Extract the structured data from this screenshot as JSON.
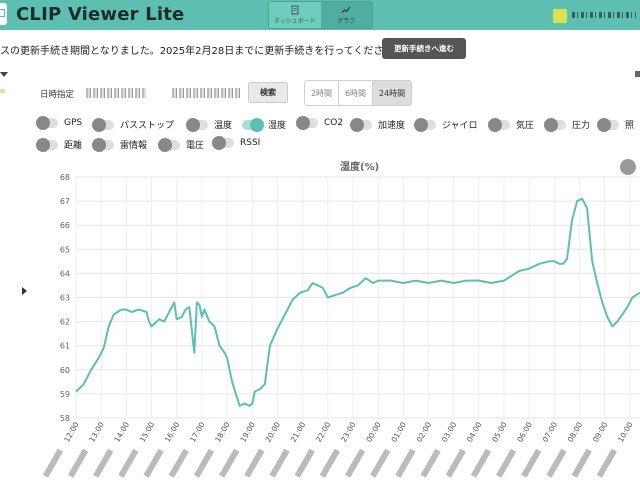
{
  "header": {
    "title": "CLIP Viewer Lite",
    "nav": [
      {
        "label": "ダッシュボード",
        "icon": "document-icon",
        "active": false
      },
      {
        "label": "グラフ",
        "icon": "line-graph-icon",
        "active": true
      }
    ],
    "avatar_color": "#d7e24e"
  },
  "notice": {
    "text": "スの更新手続き期間となりました。2025年2月28日までに更新手続きを行ってください。",
    "button_label": "更新手続きへ進む"
  },
  "filters": {
    "date_label": "日時指定",
    "search_label": "検索",
    "ranges": [
      "2時間",
      "6時間",
      "24時間"
    ],
    "selected_range": "24時間"
  },
  "toggles": [
    {
      "label": "GPS",
      "on": false
    },
    {
      "label": "パスストップ",
      "on": false
    },
    {
      "label": "温度",
      "on": false
    },
    {
      "label": "湿度",
      "on": true
    },
    {
      "label": "CO2",
      "on": false
    },
    {
      "label": "加速度",
      "on": false
    },
    {
      "label": "ジャイロ",
      "on": false
    },
    {
      "label": "気圧",
      "on": false
    },
    {
      "label": "圧力",
      "on": false
    },
    {
      "label": "照",
      "on": false
    },
    {
      "label": "距離",
      "on": false
    },
    {
      "label": "雷情報",
      "on": false
    },
    {
      "label": "電圧",
      "on": false
    },
    {
      "label": "RSSI",
      "on": false
    }
  ],
  "chart_data": {
    "type": "line",
    "title": "湿度(%)",
    "ylim": [
      58,
      68
    ],
    "yticks": [
      58,
      59,
      60,
      61,
      62,
      63,
      64,
      65,
      66,
      67,
      68
    ],
    "xtick_labels": [
      "12:00",
      "13:00",
      "14:00",
      "15:00",
      "16:00",
      "17:00",
      "18:00",
      "19:00",
      "20:00",
      "21:00",
      "22:00",
      "23:00",
      "00:00",
      "01:00",
      "02:00",
      "03:00",
      "04:00",
      "05:00",
      "06:00",
      "07:00",
      "08:00",
      "09:00",
      "10:00"
    ],
    "xlim": [
      12.0,
      34.4
    ],
    "series": [
      {
        "color": "#5cbfb0",
        "x": [
          12.0,
          12.3,
          12.6,
          12.9,
          13.1,
          13.3,
          13.5,
          13.8,
          14.0,
          14.2,
          14.5,
          14.8,
          14.9,
          15.0,
          15.2,
          15.3,
          15.5,
          15.7,
          15.9,
          16.0,
          16.2,
          16.35,
          16.5,
          16.7,
          16.8,
          16.9,
          17.0,
          17.1,
          17.3,
          17.5,
          17.7,
          17.9,
          18.0,
          18.2,
          18.35,
          18.5,
          18.7,
          18.9,
          19.0,
          19.1,
          19.3,
          19.5,
          19.7,
          20.0,
          20.3,
          20.6,
          20.9,
          21.2,
          21.4,
          21.6,
          21.8,
          22.0,
          22.3,
          22.6,
          22.9,
          23.2,
          23.5,
          23.8,
          24.0,
          24.5,
          25.0,
          25.5,
          26.0,
          26.5,
          27.0,
          27.5,
          28.0,
          28.5,
          29.0,
          29.3,
          29.6,
          30.0,
          30.4,
          30.8,
          31.0,
          31.2,
          31.35,
          31.5,
          31.7,
          31.9,
          32.1,
          32.3,
          32.5,
          32.7,
          32.9,
          33.1,
          33.3,
          33.5,
          33.7,
          33.9,
          34.1,
          34.4
        ],
        "y": [
          59.1,
          59.4,
          60.0,
          60.5,
          60.9,
          61.8,
          62.3,
          62.5,
          62.5,
          62.4,
          62.5,
          62.4,
          62.0,
          61.8,
          62.0,
          62.1,
          62.0,
          62.4,
          62.8,
          62.1,
          62.2,
          62.5,
          62.6,
          60.7,
          62.8,
          62.7,
          62.2,
          62.5,
          62.0,
          61.8,
          61.0,
          60.7,
          60.5,
          59.5,
          59.0,
          58.5,
          58.6,
          58.5,
          58.6,
          59.1,
          59.2,
          59.4,
          61.0,
          61.7,
          62.3,
          62.9,
          63.2,
          63.3,
          63.6,
          63.5,
          63.4,
          63.0,
          63.1,
          63.2,
          63.4,
          63.5,
          63.8,
          63.6,
          63.7,
          63.7,
          63.6,
          63.7,
          63.6,
          63.7,
          63.6,
          63.7,
          63.7,
          63.6,
          63.7,
          63.9,
          64.1,
          64.2,
          64.4,
          64.5,
          64.5,
          64.4,
          64.4,
          64.6,
          66.2,
          67.0,
          67.1,
          66.7,
          64.5,
          63.6,
          62.8,
          62.2,
          61.8,
          62.0,
          62.3,
          62.6,
          63.0,
          63.2
        ]
      }
    ]
  }
}
